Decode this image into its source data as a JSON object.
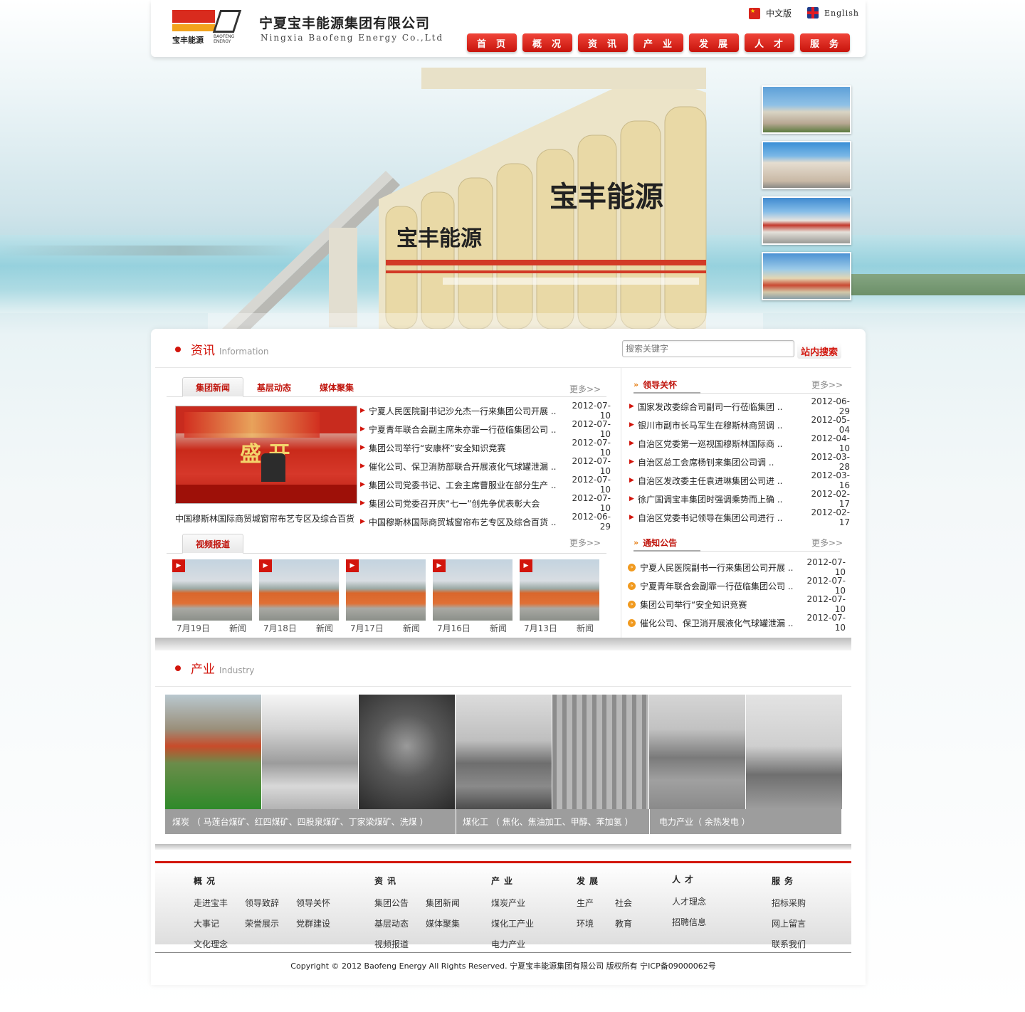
{
  "header": {
    "brand_cn": "宁夏宝丰能源集团有限公司",
    "brand_en": "Ningxia Baofeng Energy Co.,Ltd",
    "logo_cn": "宝丰能源",
    "logo_en": "BAOFENG ENERGY",
    "lang_cn": "中文版",
    "lang_en": "English",
    "nav": [
      "首页",
      "概况",
      "资讯",
      "产业",
      "发展",
      "人才",
      "服务"
    ]
  },
  "banner": {
    "silo_text": "宝丰能源"
  },
  "info": {
    "title_cn": "资讯",
    "title_en": "Information",
    "search_placeholder": "搜索关键字",
    "search_button": "站内搜索",
    "tabs": [
      "集团新闻",
      "基层动态",
      "媒体聚集"
    ],
    "more": "更多>>",
    "photo_caption": "中国穆斯林国际商贸城窗帘布艺专区及综合百货",
    "news": [
      {
        "title": "宁夏人民医院副书记沙允杰一行来集团公司开展 ..",
        "date": "2012-07-10"
      },
      {
        "title": "宁夏青年联合会副主席朱亦霏一行莅临集团公司 ..",
        "date": "2012-07-10"
      },
      {
        "title": "集团公司举行“安康杯”安全知识竞赛",
        "date": "2012-07-10"
      },
      {
        "title": "催化公司、保卫消防部联合开展液化气球罐泄漏 ..",
        "date": "2012-07-10"
      },
      {
        "title": "集团公司党委书记、工会主席曹服业在部分生产 ..",
        "date": "2012-07-10"
      },
      {
        "title": "集团公司党委召开庆“七一”创先争优表彰大会",
        "date": "2012-07-10"
      },
      {
        "title": "中国穆斯林国际商贸城窗帘布艺专区及综合百货 ..",
        "date": "2012-06-29"
      }
    ],
    "video_tab": "视频报道",
    "videos": [
      {
        "date": "7月19日",
        "tag": "新闻"
      },
      {
        "date": "7月18日",
        "tag": "新闻"
      },
      {
        "date": "7月17日",
        "tag": "新闻"
      },
      {
        "date": "7月16日",
        "tag": "新闻"
      },
      {
        "date": "7月13日",
        "tag": "新闻"
      }
    ]
  },
  "leaders": {
    "title": "领导关怀",
    "more": "更多>>",
    "items": [
      {
        "title": "国家发改委综合司副司一行莅临集团 ..",
        "date": "2012-06-29"
      },
      {
        "title": "银川市副市长马军生在穆斯林商贸调 ..",
        "date": "2012-05-04"
      },
      {
        "title": "自治区党委第一巡视国穆斯林国际商 ..",
        "date": "2012-04-10"
      },
      {
        "title": "自治区总工会席杨钊来集团公司调 ..",
        "date": "2012-03-28"
      },
      {
        "title": "自治区发改委主任袁进琳集团公司进 ..",
        "date": "2012-03-16"
      },
      {
        "title": "徐广国调宝丰集团时强调乘势而上确 ..",
        "date": "2012-02-17"
      },
      {
        "title": "自治区党委书记领导在集团公司进行 ..",
        "date": "2012-02-17"
      }
    ]
  },
  "notices": {
    "title": "通知公告",
    "more": "更多>>",
    "items": [
      {
        "title": "宁夏人民医院副书一行来集团公司开展 ..",
        "date": "2012-07-10"
      },
      {
        "title": "宁夏青年联合会副霏一行莅临集团公司 ..",
        "date": "2012-07-10"
      },
      {
        "title": "集团公司举行“安全知识竞赛",
        "date": "2012-07-10"
      },
      {
        "title": "催化公司、保卫消开展液化气球罐泄漏 ..",
        "date": "2012-07-10"
      }
    ]
  },
  "industry": {
    "title_cn": "产业",
    "title_en": "Industry",
    "cap1": "煤炭 （ 马莲台煤矿、红四煤矿、四股泉煤矿、丁家梁煤矿、洗煤 ）",
    "cap2": "煤化工 （ 焦化、焦油加工、甲醇、苯加氢 ）",
    "cap3": "电力产业（ 余热发电 ）"
  },
  "footer": {
    "cols": [
      {
        "title": "概况",
        "links": [
          "走进宝丰",
          "领导致辞",
          "领导关怀",
          "大事记",
          "荣誉展示",
          "党群建设",
          "文化理念"
        ]
      },
      {
        "title": "资讯",
        "links": [
          "集团公告",
          "集团新闻",
          "基层动态",
          "媒体聚集",
          "视频报道"
        ]
      },
      {
        "title": "产业",
        "links": [
          "煤炭产业",
          "煤化工产业",
          "电力产业"
        ]
      },
      {
        "title": "发展",
        "links": [
          "生产",
          "社会",
          "环境",
          "教育"
        ]
      },
      {
        "title": "人才",
        "links": [
          "人才理念",
          "招聘信息"
        ]
      },
      {
        "title": "服务",
        "links": [
          "招标采购",
          "网上留言",
          "联系我们"
        ]
      }
    ],
    "copyright": "Copyright © 2012 Baofeng Energy All Rights Reserved.  宁夏宝丰能源集团有限公司   版权所有   宁ICP备09000062号"
  }
}
